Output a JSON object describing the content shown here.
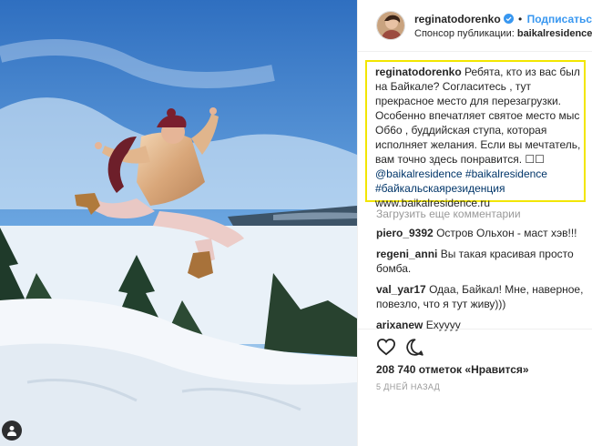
{
  "post": {
    "username": "reginatodorenko",
    "separator": "•",
    "follow_label": "Подписаться",
    "sponsor_prefix": "Спонсор публикации: ",
    "sponsor_name": "baikalresidence"
  },
  "caption": {
    "username": "reginatodorenko",
    "text": " Ребята, кто из вас был на Байкале? Согласитесь , тут прекрасное место для перезагрузки. Особенно впечатляет святое место мыс Об6о , буддийская ступа, которая исполняет желания. Если вы мечтатель, вам точно здесь понравится. ☐☐ ",
    "mention": "@baikalresidence",
    "hashtags": "#baikalresidence #байкальскаярезиденция",
    "website": "www.baikalresidence.ru"
  },
  "load_more_label": "Загрузить еще комментарии",
  "comments": [
    {
      "user": "piero_9392",
      "text": "Остров Ольхон - маст хэв!!!"
    },
    {
      "user": "regeni_anni",
      "text": "Вы такая красивая просто бомба."
    },
    {
      "user": "val_yar17",
      "text": "Одаа, Байкал! Мне, наверное, повезло, что я тут живу)))"
    },
    {
      "user": "arixanew",
      "text": "Еxyyyy"
    }
  ],
  "likes_text": "208 740 отметок «Нравится»",
  "time_text": "5 ДНЕЙ НАЗАД",
  "icons": {
    "verified": "verified-badge-icon",
    "like": "heart-icon",
    "comment": "comment-bubble-icon",
    "user_tag": "user-tag-icon"
  },
  "colors": {
    "follow": "#3897f0",
    "highlight_border": "#f2e600",
    "link": "#003569",
    "muted": "#999999"
  }
}
